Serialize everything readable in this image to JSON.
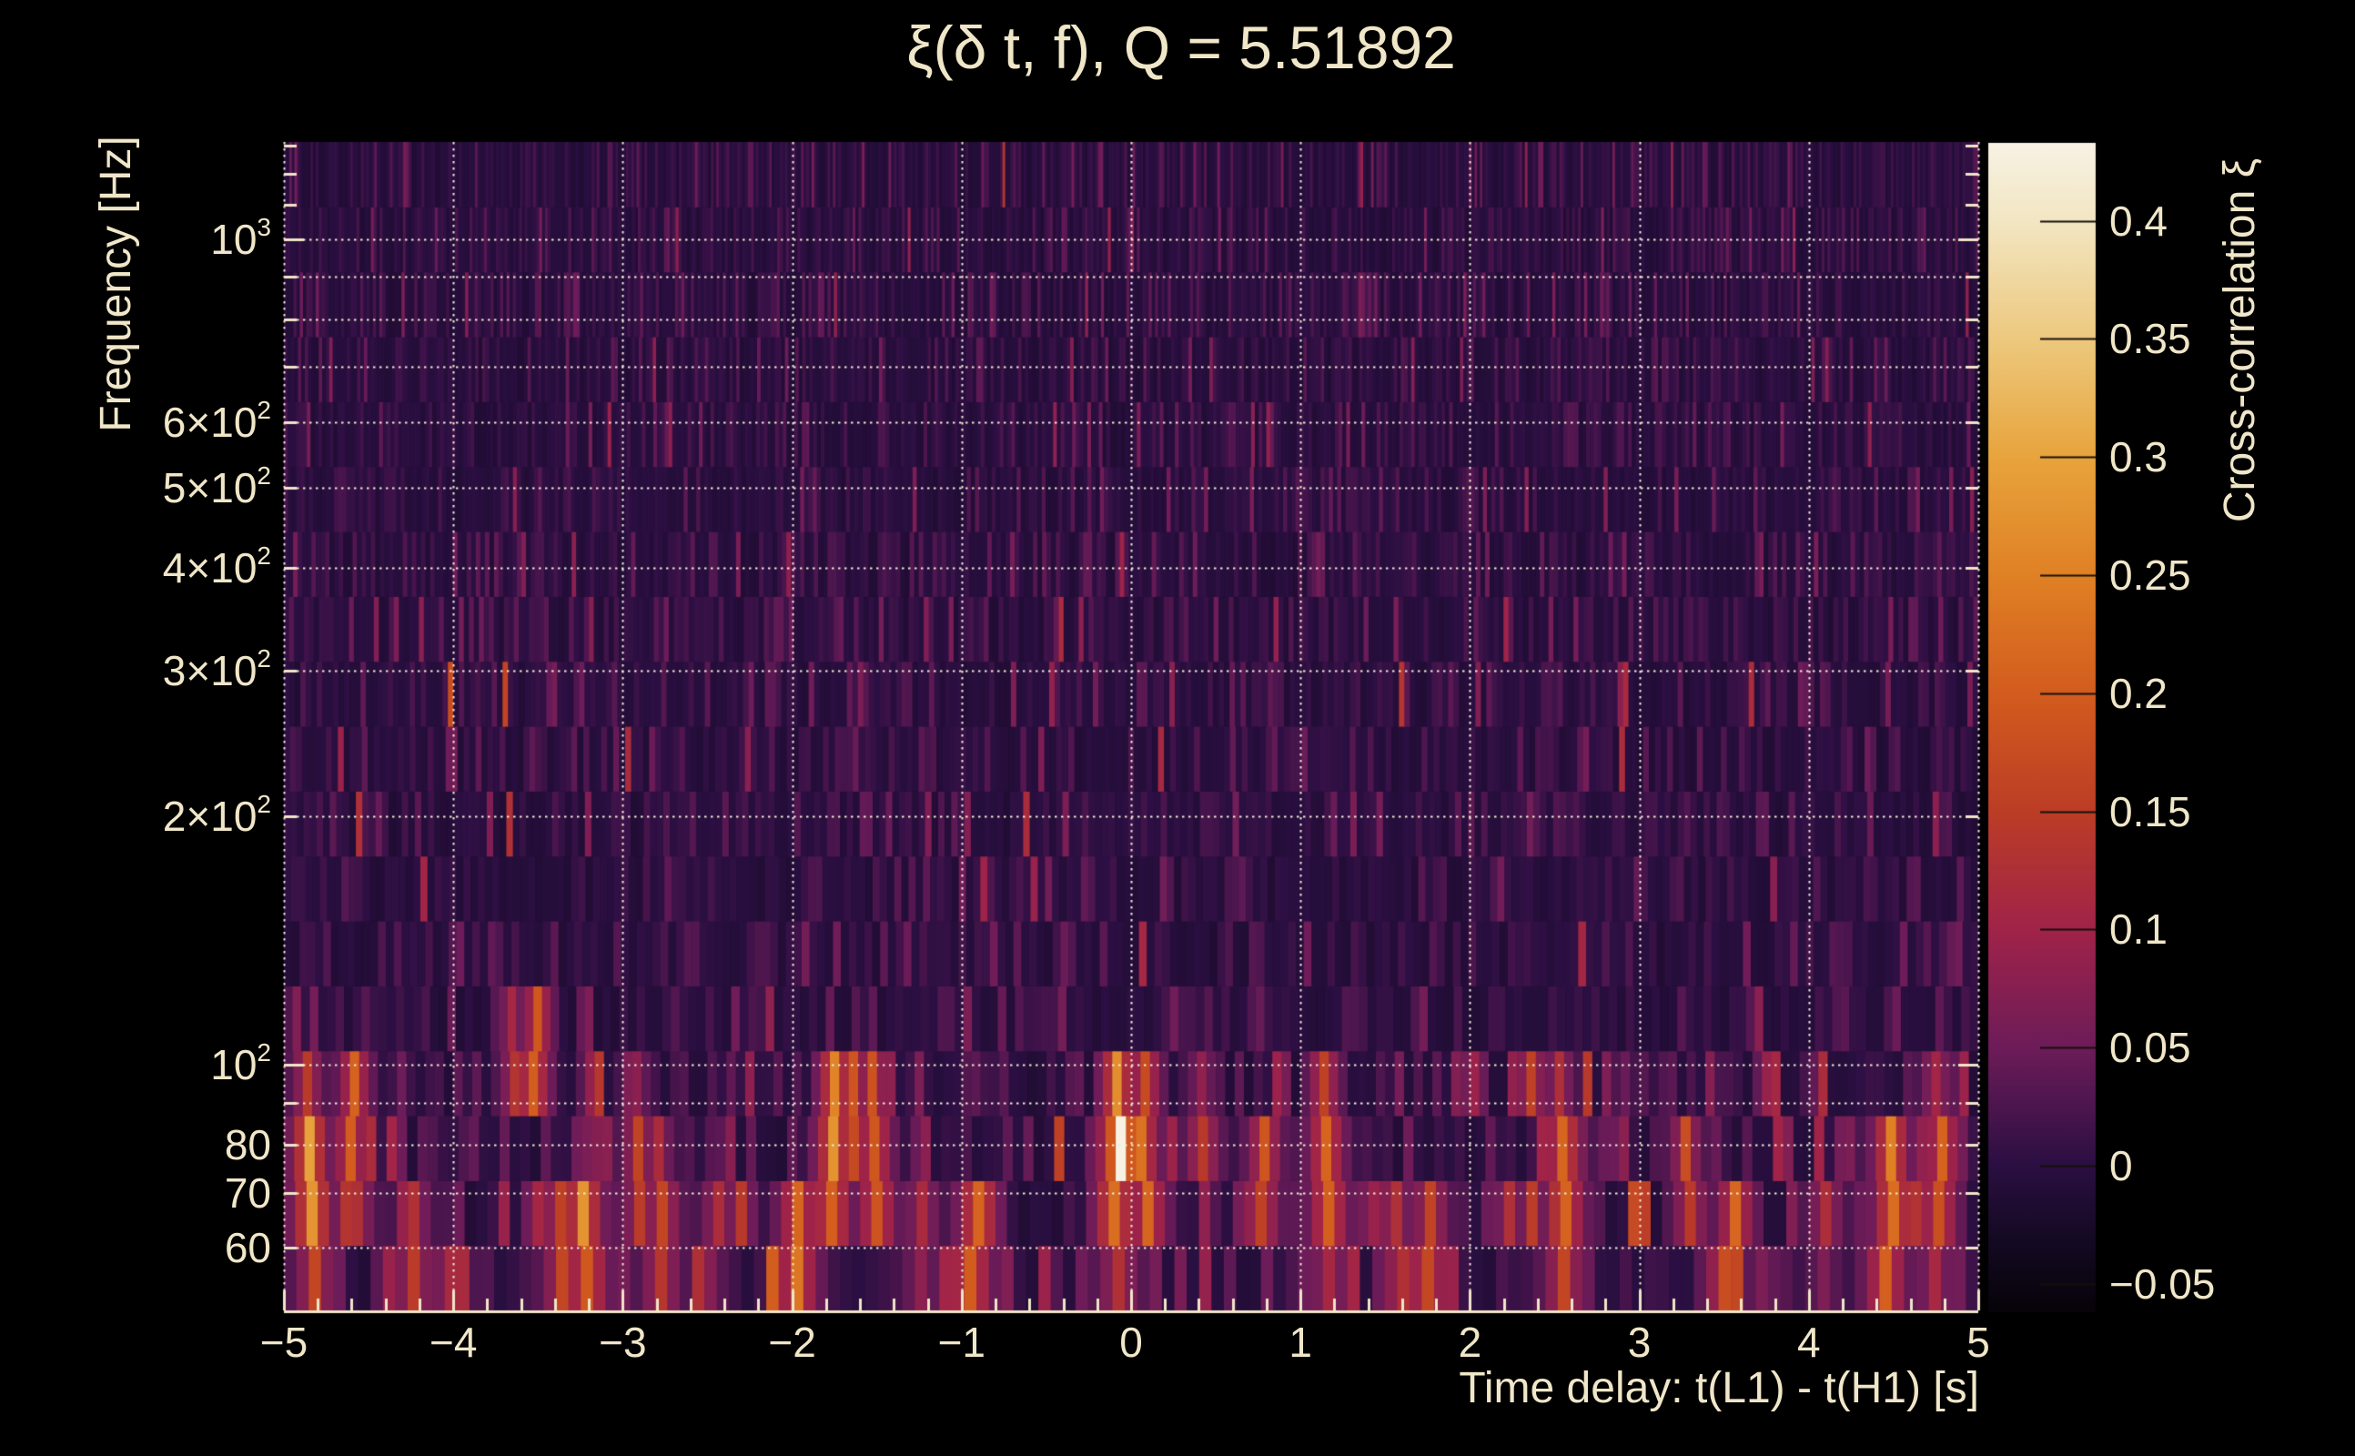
{
  "chart_data": {
    "type": "heatmap",
    "title": "ξ(δ t, f), Q = 5.51892",
    "xlabel": "Time delay: t(L1) - t(H1) [s]",
    "ylabel": "Frequency [Hz]",
    "colorbar_label": "Cross-correlation ξ",
    "x_range": [
      -5,
      5
    ],
    "y_range": [
      50.4,
      1312
    ],
    "y_scale": "log",
    "z_range": [
      -0.062,
      0.433
    ],
    "grid": "dotted",
    "x_ticks": [
      {
        "v": -5,
        "label": "−5"
      },
      {
        "v": -4,
        "label": "−4"
      },
      {
        "v": -3,
        "label": "−3"
      },
      {
        "v": -2,
        "label": "−2"
      },
      {
        "v": -1,
        "label": "−1"
      },
      {
        "v": 0,
        "label": "0"
      },
      {
        "v": 1,
        "label": "1"
      },
      {
        "v": 2,
        "label": "2"
      },
      {
        "v": 3,
        "label": "3"
      },
      {
        "v": 4,
        "label": "4"
      },
      {
        "v": 5,
        "label": "5"
      }
    ],
    "x_minor_step": 0.2,
    "y_ticks": [
      {
        "v": 1000,
        "base": "10",
        "exp": "3"
      },
      {
        "v": 600,
        "base": "6×10",
        "exp": "2"
      },
      {
        "v": 500,
        "base": "5×10",
        "exp": "2"
      },
      {
        "v": 400,
        "base": "4×10",
        "exp": "2"
      },
      {
        "v": 300,
        "base": "3×10",
        "exp": "2"
      },
      {
        "v": 200,
        "base": "2×10",
        "exp": "2"
      },
      {
        "v": 100,
        "base": "10",
        "exp": "2"
      },
      {
        "v": 80,
        "base": "80"
      },
      {
        "v": 70,
        "base": "70"
      },
      {
        "v": 60,
        "base": "60"
      }
    ],
    "y_minor_ticks": [
      60,
      70,
      80,
      90,
      100,
      200,
      300,
      400,
      500,
      600,
      700,
      800,
      900,
      1000,
      1100,
      1200,
      1300
    ],
    "x_grid": [
      -5,
      -4,
      -3,
      -2,
      -1,
      0,
      1,
      2,
      3,
      4,
      5
    ],
    "y_grid": [
      60,
      70,
      80,
      90,
      100,
      200,
      300,
      400,
      500,
      600,
      700,
      800,
      900,
      1000
    ],
    "colorbar_ticks": [
      {
        "v": 0.4,
        "label": "0.4"
      },
      {
        "v": 0.35,
        "label": "0.35"
      },
      {
        "v": 0.3,
        "label": "0.3"
      },
      {
        "v": 0.25,
        "label": "0.25"
      },
      {
        "v": 0.2,
        "label": "0.2"
      },
      {
        "v": 0.15,
        "label": "0.15"
      },
      {
        "v": 0.1,
        "label": "0.1"
      },
      {
        "v": 0.05,
        "label": "0.05"
      },
      {
        "v": 0,
        "label": "0"
      },
      {
        "v": -0.05,
        "label": "−0.05"
      }
    ],
    "colormap_stops": [
      {
        "v": -0.062,
        "color": "#060309"
      },
      {
        "v": -0.03,
        "color": "#150a24"
      },
      {
        "v": 0.0,
        "color": "#2b0f42"
      },
      {
        "v": 0.05,
        "color": "#6d1c59"
      },
      {
        "v": 0.1,
        "color": "#a02349"
      },
      {
        "v": 0.15,
        "color": "#bc3d26"
      },
      {
        "v": 0.2,
        "color": "#d35c1e"
      },
      {
        "v": 0.25,
        "color": "#e08125"
      },
      {
        "v": 0.3,
        "color": "#e8a43d"
      },
      {
        "v": 0.35,
        "color": "#edc97e"
      },
      {
        "v": 0.4,
        "color": "#f3e6c3"
      },
      {
        "v": 0.433,
        "color": "#f7f2e4"
      }
    ],
    "style": {
      "text_color": "#f0e6c8",
      "grid_color": "#f2ecd9",
      "axis_color": "#f0e6c8",
      "background": "#000000"
    },
    "noise": {
      "seed": 20240917,
      "rows": 18,
      "tile_sec_at_60hz": 0.07,
      "offset": 0.012,
      "scale_high": 0.016,
      "scale_mid": 0.02,
      "scale_low": 0.034,
      "hot_below_hz": 112,
      "mid_below_hz": 420,
      "jitter": 0.003
    },
    "features": [
      {
        "t": -4.85,
        "f_lo": 55,
        "f_hi": 95,
        "xi": 0.28
      },
      {
        "t": -4.6,
        "f_lo": 64,
        "f_hi": 108,
        "xi": 0.2
      },
      {
        "t": -4.25,
        "f_lo": 51,
        "f_hi": 68,
        "xi": 0.15
      },
      {
        "t": -3.98,
        "f_lo": 51,
        "f_hi": 66,
        "xi": 0.13
      },
      {
        "t": -3.66,
        "f_lo": 88,
        "f_hi": 118,
        "xi": 0.14
      },
      {
        "t": -3.51,
        "f_lo": 86,
        "f_hi": 118,
        "xi": 0.24
      },
      {
        "t": -3.37,
        "f_lo": 51,
        "f_hi": 74,
        "xi": 0.17
      },
      {
        "t": -3.23,
        "f_lo": 51,
        "f_hi": 78,
        "xi": 0.26
      },
      {
        "t": -2.92,
        "f_lo": 60,
        "f_hi": 95,
        "xi": 0.15
      },
      {
        "t": -2.77,
        "f_lo": 51,
        "f_hi": 80,
        "xi": 0.17
      },
      {
        "t": -2.45,
        "f_lo": 55,
        "f_hi": 75,
        "xi": 0.13
      },
      {
        "t": -1.94,
        "f_lo": 50,
        "f_hi": 72,
        "xi": 0.22
      },
      {
        "t": -1.76,
        "f_lo": 58,
        "f_hi": 104,
        "xi": 0.26
      },
      {
        "t": -1.63,
        "f_lo": 68,
        "f_hi": 108,
        "xi": 0.18
      },
      {
        "t": -1.52,
        "f_lo": 58,
        "f_hi": 100,
        "xi": 0.22
      },
      {
        "t": -1.25,
        "f_lo": 53,
        "f_hi": 75,
        "xi": 0.12
      },
      {
        "t": -0.92,
        "f_lo": 51,
        "f_hi": 75,
        "xi": 0.25
      },
      {
        "t": -0.07,
        "f_lo": 55,
        "f_hi": 105,
        "xi": 0.26
      },
      {
        "t": -0.07,
        "f_lo": 70,
        "f_hi": 82,
        "xi": 0.43
      },
      {
        "t": 0.08,
        "f_lo": 60,
        "f_hi": 100,
        "xi": 0.24
      },
      {
        "t": 0.43,
        "f_lo": 73,
        "f_hi": 95,
        "xi": 0.17
      },
      {
        "t": 0.77,
        "f_lo": 60,
        "f_hi": 88,
        "xi": 0.19
      },
      {
        "t": 1.15,
        "f_lo": 55,
        "f_hi": 100,
        "xi": 0.23
      },
      {
        "t": 1.58,
        "f_lo": 51,
        "f_hi": 70,
        "xi": 0.12
      },
      {
        "t": 1.74,
        "f_lo": 51,
        "f_hi": 68,
        "xi": 0.2
      },
      {
        "t": 2.26,
        "f_lo": 62,
        "f_hi": 78,
        "xi": 0.12
      },
      {
        "t": 2.37,
        "f_lo": 85,
        "f_hi": 112,
        "xi": 0.16
      },
      {
        "t": 2.54,
        "f_lo": 51,
        "f_hi": 95,
        "xi": 0.22
      },
      {
        "t": 3.28,
        "f_lo": 58,
        "f_hi": 90,
        "xi": 0.15
      },
      {
        "t": 3.54,
        "f_lo": 51,
        "f_hi": 75,
        "xi": 0.2
      },
      {
        "t": 4.1,
        "f_lo": 55,
        "f_hi": 75,
        "xi": 0.13
      },
      {
        "t": 4.48,
        "f_lo": 51,
        "f_hi": 86,
        "xi": 0.26
      },
      {
        "t": 4.66,
        "f_lo": 58,
        "f_hi": 80,
        "xi": 0.15
      },
      {
        "t": 4.77,
        "f_lo": 55,
        "f_hi": 96,
        "xi": 0.21
      }
    ]
  }
}
